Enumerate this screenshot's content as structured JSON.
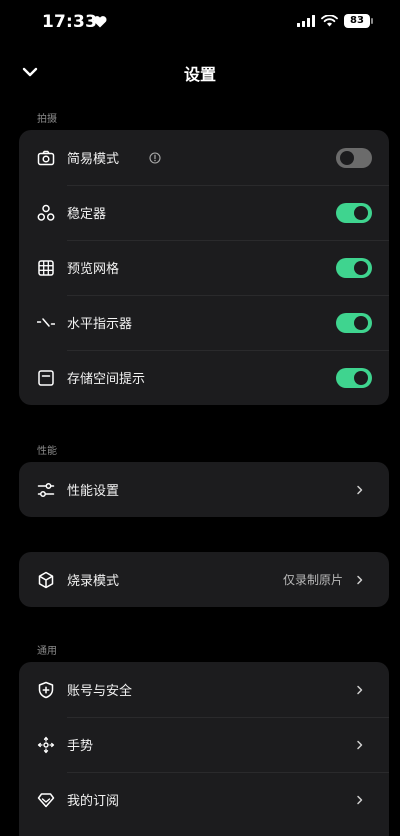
{
  "status": {
    "time": "17:33",
    "battery": "83"
  },
  "nav": {
    "title": "设置"
  },
  "sections": {
    "capture": {
      "label": "拍摄",
      "items": [
        {
          "label": "简易模式",
          "toggle": false,
          "icon": "camera-icon"
        },
        {
          "label": "稳定器",
          "toggle": true,
          "icon": "stabilizer-icon"
        },
        {
          "label": "预览网格",
          "toggle": true,
          "icon": "grid-icon"
        },
        {
          "label": "水平指示器",
          "toggle": true,
          "icon": "level-icon"
        },
        {
          "label": "存储空间提示",
          "toggle": true,
          "icon": "storage-icon"
        }
      ]
    },
    "performance": {
      "label": "性能",
      "items": [
        {
          "label": "性能设置",
          "icon": "sliders-icon"
        }
      ]
    },
    "burn": {
      "items": [
        {
          "label": "烧录模式",
          "value": "仅录制原片",
          "icon": "cube-icon"
        }
      ]
    },
    "general": {
      "label": "通用",
      "items": [
        {
          "label": "账号与安全",
          "icon": "shield-icon"
        },
        {
          "label": "手势",
          "icon": "gesture-icon"
        },
        {
          "label": "我的订阅",
          "icon": "subscription-icon"
        }
      ]
    }
  },
  "colors": {
    "accent": "#3fd48f",
    "card": "#1c1c1e",
    "background": "#000000"
  }
}
